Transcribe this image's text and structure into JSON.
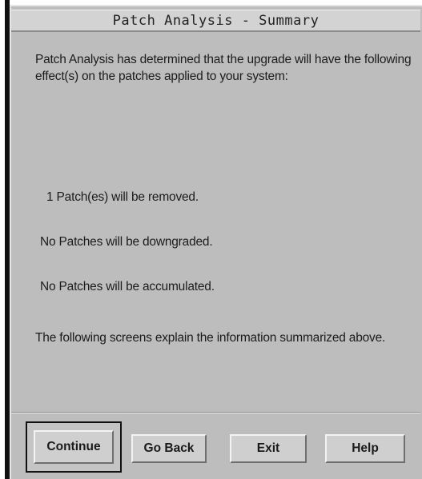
{
  "window": {
    "title": "Patch Analysis - Summary"
  },
  "content": {
    "intro": "Patch Analysis has determined that the upgrade will have the following effect(s) on the patches applied to your system:",
    "removed": "1 Patch(es) will be removed.",
    "downgraded": "No Patches will be downgraded.",
    "accumulated": "No Patches will be accumulated.",
    "outro": "The following screens explain the information summarized above."
  },
  "buttons": {
    "continue": "Continue",
    "go_back": "Go Back",
    "exit": "Exit",
    "help": "Help"
  }
}
